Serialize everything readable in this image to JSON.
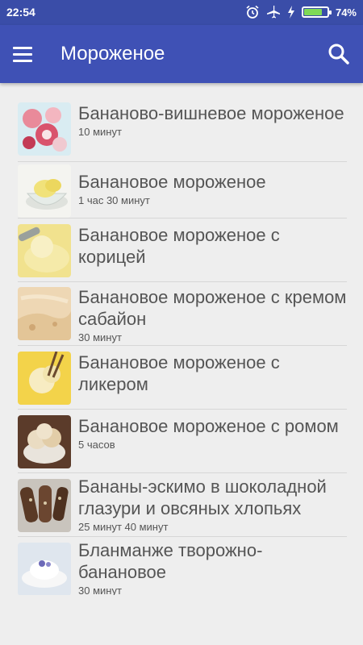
{
  "status_bar": {
    "time": "22:54",
    "battery_percent": "74%",
    "battery_level": 0.74,
    "icons": [
      "alarm-icon",
      "airplane-mode-icon",
      "charging-icon",
      "battery-icon"
    ]
  },
  "app_bar": {
    "title": "Мороженое",
    "menu_icon": "hamburger-menu-icon",
    "search_icon": "search-icon",
    "color": "#3f51b5"
  },
  "recipes": [
    {
      "name": "Бананово-вишневое мороженое",
      "time": "10 минут",
      "thumb": "cherry-banana-icecream"
    },
    {
      "name": "Банановое мороженое",
      "time": "1 час 30 минут",
      "thumb": "banana-icecream-bowl"
    },
    {
      "name": "Банановое мороженое с корицей",
      "time": "",
      "thumb": "cinnamon-icecream-scoop"
    },
    {
      "name": "Банановое мороженое с кремом сабайон",
      "time": "30 минут",
      "thumb": "sabayon-icecream"
    },
    {
      "name": "Банановое мороженое с ликером",
      "time": "",
      "thumb": "liqueur-icecream"
    },
    {
      "name": "Банановое мороженое с ромом",
      "time": "5 часов",
      "thumb": "rum-icecream-bowl"
    },
    {
      "name": "Бананы-эскимо в шоколадной глазури и овсяных хлопьях",
      "time": "25 минут 40 минут",
      "thumb": "banana-eskimo-sticks"
    },
    {
      "name": "Бланманже творожно-банановое",
      "time": "30 минут",
      "thumb": "blancmange-plate"
    }
  ]
}
